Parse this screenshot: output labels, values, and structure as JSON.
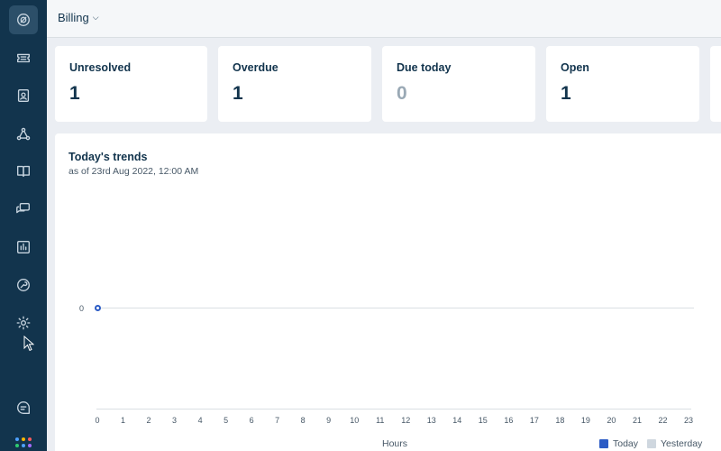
{
  "app": {
    "header_title": "Billing"
  },
  "sidebar": {
    "items": [
      {
        "name": "dashboard",
        "active": true
      },
      {
        "name": "tickets"
      },
      {
        "name": "contacts"
      },
      {
        "name": "groups"
      },
      {
        "name": "knowledge-base"
      },
      {
        "name": "conversations"
      },
      {
        "name": "reports"
      },
      {
        "name": "admin-tools"
      },
      {
        "name": "settings"
      }
    ],
    "bottom": [
      "freshdesk-chat",
      "apps-grid"
    ],
    "apps_colors": [
      "#4da1ff",
      "#ffb700",
      "#ff5c5c",
      "#2ecc71",
      "#4da1ff",
      "#a36bff"
    ]
  },
  "stats": [
    {
      "label": "Unresolved",
      "value": "1",
      "muted": false
    },
    {
      "label": "Overdue",
      "value": "1",
      "muted": false
    },
    {
      "label": "Due today",
      "value": "0",
      "muted": true
    },
    {
      "label": "Open",
      "value": "1",
      "muted": false
    }
  ],
  "trends": {
    "title": "Today's trends",
    "subtitle": "as of 23rd Aug 2022, 12:00 AM"
  },
  "chart_data": {
    "type": "line",
    "title": "Today's trends",
    "xlabel": "Hours",
    "ylabel": "",
    "x": [
      "0",
      "1",
      "2",
      "3",
      "4",
      "5",
      "6",
      "7",
      "8",
      "9",
      "10",
      "11",
      "12",
      "13",
      "14",
      "15",
      "16",
      "17",
      "18",
      "19",
      "20",
      "21",
      "22",
      "23"
    ],
    "y_ticks": [
      "0"
    ],
    "series": [
      {
        "name": "Today",
        "color": "#2c5cc5",
        "points": [
          {
            "x": "0",
            "y": 0
          }
        ]
      },
      {
        "name": "Yesterday",
        "color": "#cfd7df",
        "points": []
      }
    ],
    "legend_position": "bottom-right"
  }
}
